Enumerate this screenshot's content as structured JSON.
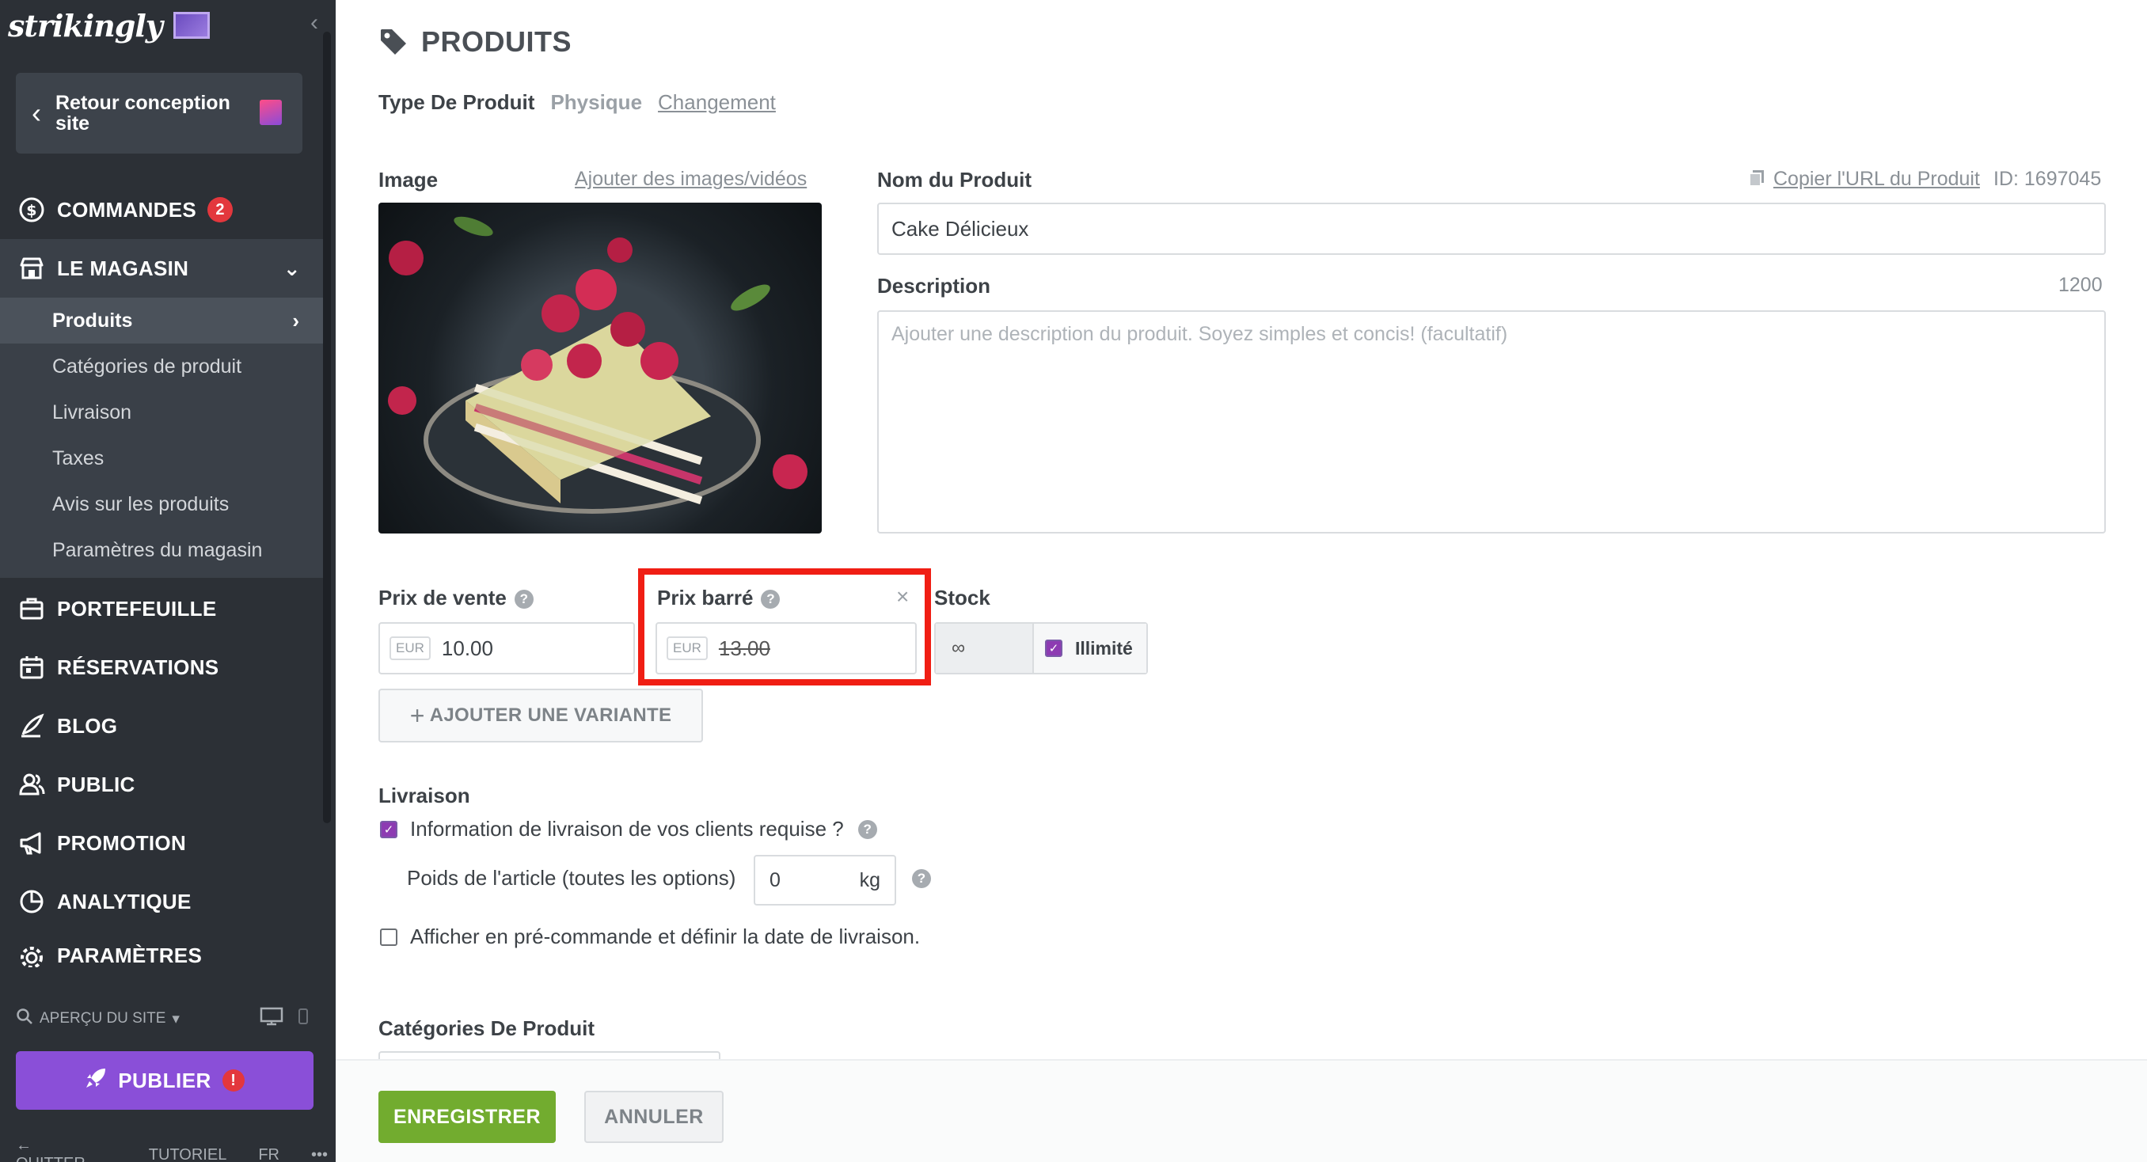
{
  "sidebar": {
    "logo": "strikingly",
    "back_label": "Retour conception site",
    "nav": [
      {
        "label": "COMMANDES",
        "icon": "dollar-circle-icon",
        "badge": "2"
      },
      {
        "label": "LE MAGASIN",
        "icon": "store-icon"
      },
      {
        "label": "PORTEFEUILLE",
        "icon": "portfolio-icon"
      },
      {
        "label": "RÉSERVATIONS",
        "icon": "calendar-icon"
      },
      {
        "label": "BLOG",
        "icon": "quill-icon"
      },
      {
        "label": "PUBLIC",
        "icon": "people-icon"
      },
      {
        "label": "PROMOTION",
        "icon": "megaphone-icon"
      },
      {
        "label": "ANALYTIQUE",
        "icon": "pie-chart-icon"
      },
      {
        "label": "PARAMÈTRES",
        "icon": "gear-icon"
      }
    ],
    "store_items": [
      {
        "label": "Produits"
      },
      {
        "label": "Catégories de produit"
      },
      {
        "label": "Livraison"
      },
      {
        "label": "Taxes"
      },
      {
        "label": "Avis sur les produits"
      },
      {
        "label": "Paramètres du magasin"
      }
    ],
    "preview_label": "APERÇU DU SITE",
    "publish_label": "PUBLIER",
    "publish_alert": "!",
    "bottom": {
      "quit": "QUITTER",
      "tutorial": "TUTORIEL",
      "lang": "FR",
      "more": "•••"
    }
  },
  "main": {
    "title": "PRODUITS",
    "type_label": "Type De Produit",
    "type_value": "Physique",
    "type_change": "Changement",
    "image_label": "Image",
    "add_media": "Ajouter des images/vidéos",
    "name_label": "Nom du Produit",
    "copy_url": "Copier l'URL du Produit",
    "product_id": "ID: 1697045",
    "name_value": "Cake Délicieux",
    "description_label": "Description",
    "description_count": "1200",
    "description_placeholder": "Ajouter une description du produit. Soyez simples et concis! (facultatif)",
    "sale_price_label": "Prix de vente",
    "currency": "EUR",
    "sale_price": "10.00",
    "strike_price_label": "Prix barré",
    "strike_price": "13.00",
    "stock_label": "Stock",
    "stock_value": "∞",
    "stock_unlimited": "Illimité",
    "add_variant": "AJOUTER UNE VARIANTE",
    "shipping_label": "Livraison",
    "shipping_info": "Information de livraison de vos clients requise ?",
    "weight_label": "Poids de l'article (toutes les options)",
    "weight_value": "0",
    "weight_unit": "kg",
    "preorder": "Afficher en pré-commande et définir la date de livraison.",
    "categories_label": "Catégories De Produit",
    "save": "ENREGISTRER",
    "cancel": "ANNULER"
  },
  "colors": {
    "sidebar": "#2c3036",
    "publish": "#8a4fd8",
    "save": "#72ac2f",
    "highlight": "#f01e14",
    "badge": "#e3373d"
  }
}
